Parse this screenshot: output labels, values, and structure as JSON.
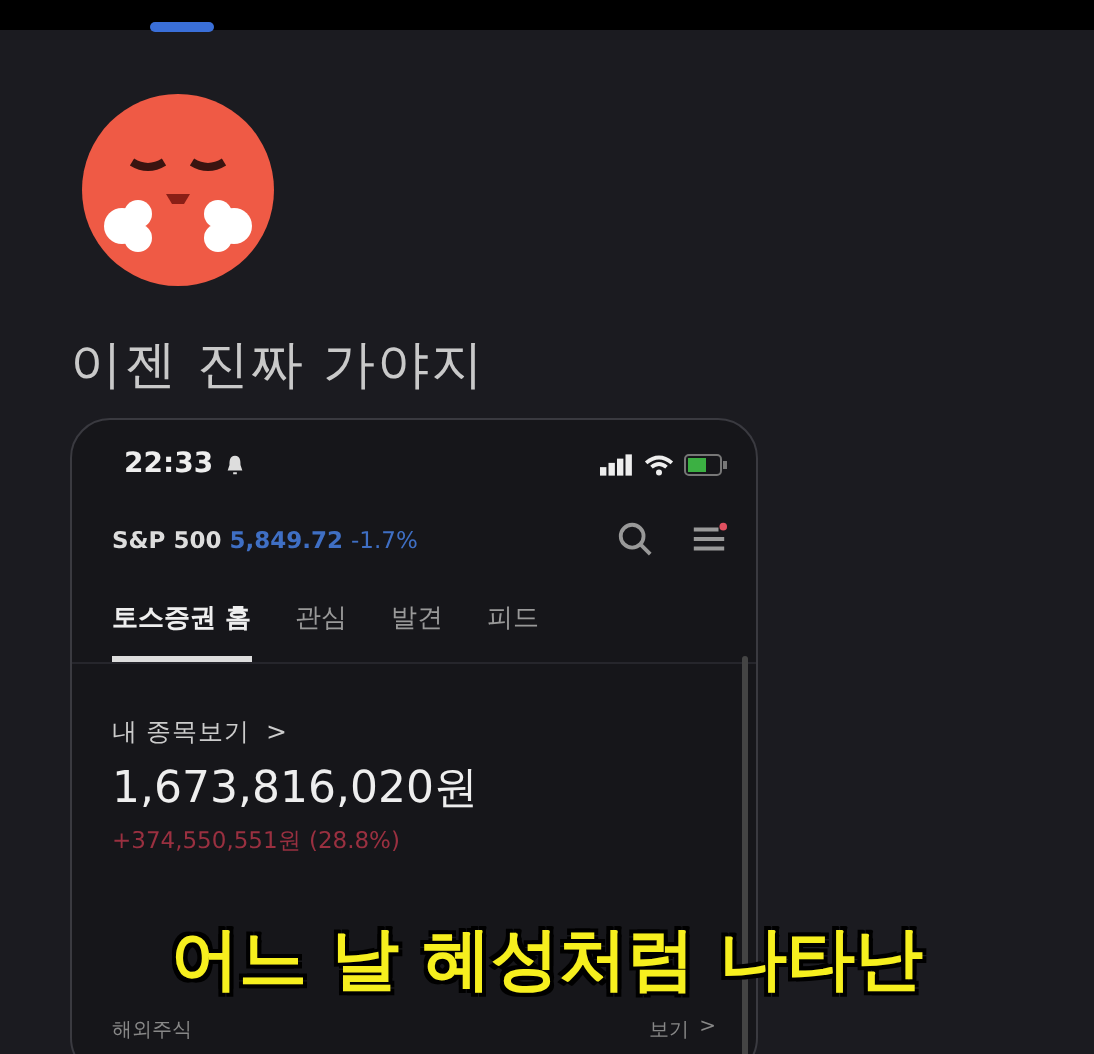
{
  "message": {
    "text": "이젠 진짜 가야지"
  },
  "phone": {
    "status_bar": {
      "time": "22:33"
    },
    "ticker": {
      "name": "S&P 500",
      "value": "5,849.72",
      "change": "-1.7%"
    },
    "tabs": [
      {
        "label": "토스증권 홈",
        "selected": true
      },
      {
        "label": "관심",
        "selected": false
      },
      {
        "label": "발견",
        "selected": false
      },
      {
        "label": "피드",
        "selected": false
      }
    ],
    "portfolio": {
      "link": "내 종목보기",
      "chevron": ">",
      "total": "1,673,816,020원",
      "gain": "+374,550,551원 (28.8%)"
    },
    "section": {
      "title": "해외주식",
      "link": "보기",
      "chevron": ">"
    }
  },
  "subtitle": "어느 날 혜성처럼 나타난"
}
